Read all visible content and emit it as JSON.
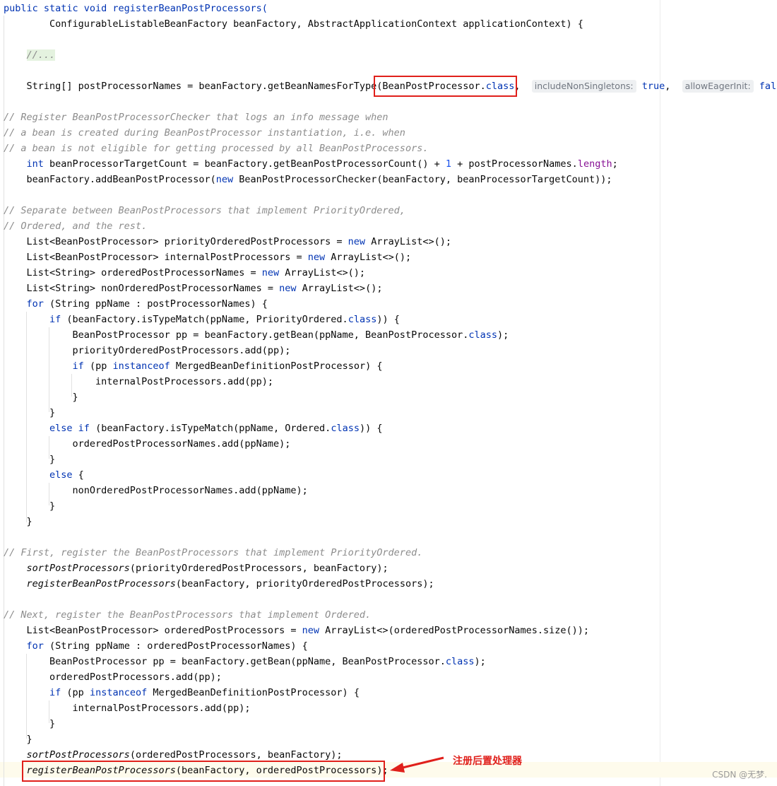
{
  "editor": {
    "method_signature": "public static void registerBeanPostProcessors(",
    "method_params": "ConfigurableListableBeanFactory beanFactory, AbstractApplicationContext applicationContext) {",
    "folded_block": "//...",
    "hints": {
      "include_non_singletons": "includeNonSingletons:",
      "allow_eager_init": "allowEagerInit:"
    },
    "comments": {
      "c1": "// Register BeanPostProcessorChecker that logs an info message when",
      "c2": "// a bean is created during BeanPostProcessor instantiation, i.e. when",
      "c3": "// a bean is not eligible for getting processed by all BeanPostProcessors.",
      "c4": "// Separate between BeanPostProcessors that implement PriorityOrdered,",
      "c5": "// Ordered, and the rest.",
      "c6": "// First, register the BeanPostProcessors that implement PriorityOrdered.",
      "c7": "// Next, register the BeanPostProcessors that implement Ordered."
    }
  },
  "annotation": {
    "label": "注册后置处理器",
    "color": "#e0201b"
  },
  "watermark": "CSDN @无梦."
}
